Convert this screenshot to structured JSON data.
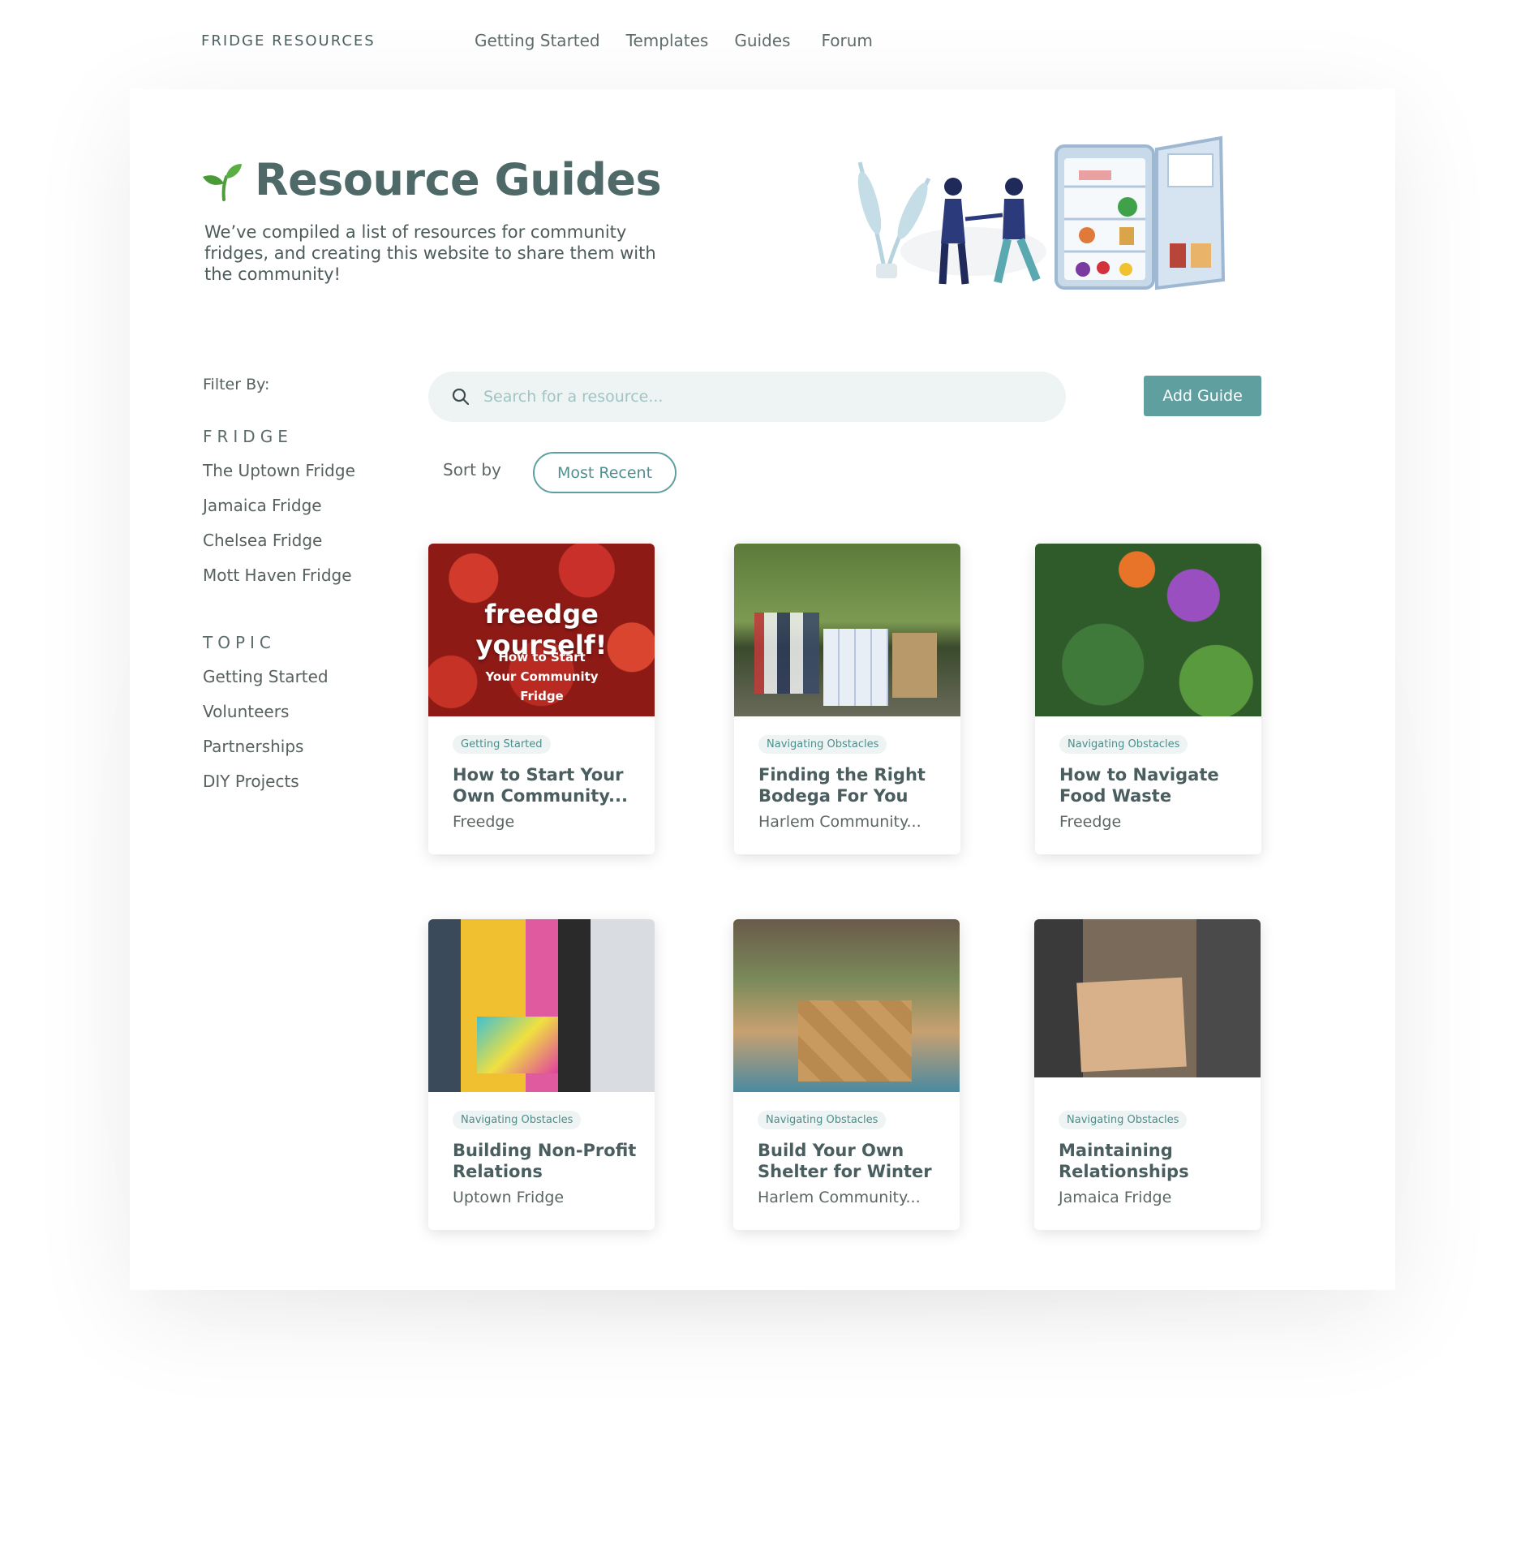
{
  "header": {
    "brand": "FRIDGE RESOURCES",
    "nav": [
      "Getting Started",
      "Templates",
      "Guides",
      "Forum"
    ]
  },
  "hero": {
    "title": "Resource Guides",
    "description": "We’ve compiled a list of resources for community fridges, and creating this website to share them with the community!"
  },
  "filters": {
    "label": "Filter By:",
    "fridge_heading": "FRIDGE",
    "fridges": [
      "The Uptown Fridge",
      "Jamaica Fridge",
      "Chelsea Fridge",
      "Mott Haven Fridge"
    ],
    "topic_heading": "TOPIC",
    "topics": [
      "Getting Started",
      "Volunteers",
      "Partnerships",
      "DIY Projects"
    ]
  },
  "search": {
    "placeholder": "Search for a resource..."
  },
  "actions": {
    "add_guide": "Add Guide"
  },
  "sort": {
    "label": "Sort by",
    "value": "Most Recent"
  },
  "cards": [
    {
      "tag": "Getting Started",
      "title": "How to Start Your Own Community...",
      "author": "Freedge",
      "image_heading": "freedge yourself!",
      "image_sub": "How to Start Your Community Fridge"
    },
    {
      "tag": "Navigating Obstacles",
      "title": "Finding the Right Bodega For You",
      "author": "Harlem Community..."
    },
    {
      "tag": "Navigating Obstacles",
      "title": "How to Navigate Food Waste",
      "author": "Freedge"
    },
    {
      "tag": "Navigating Obstacles",
      "title": "Building Non-Profit Relations",
      "author": "Uptown Fridge"
    },
    {
      "tag": "Navigating Obstacles",
      "title": "Build Your Own Shelter for Winter",
      "author": "Harlem Community..."
    },
    {
      "tag": "Navigating Obstacles",
      "title": "Maintaining Relationships",
      "author": "Jamaica Fridge"
    }
  ],
  "colors": {
    "accent": "#5f9fa0",
    "heading": "#4e6968",
    "search_bg": "#eef4f4"
  }
}
